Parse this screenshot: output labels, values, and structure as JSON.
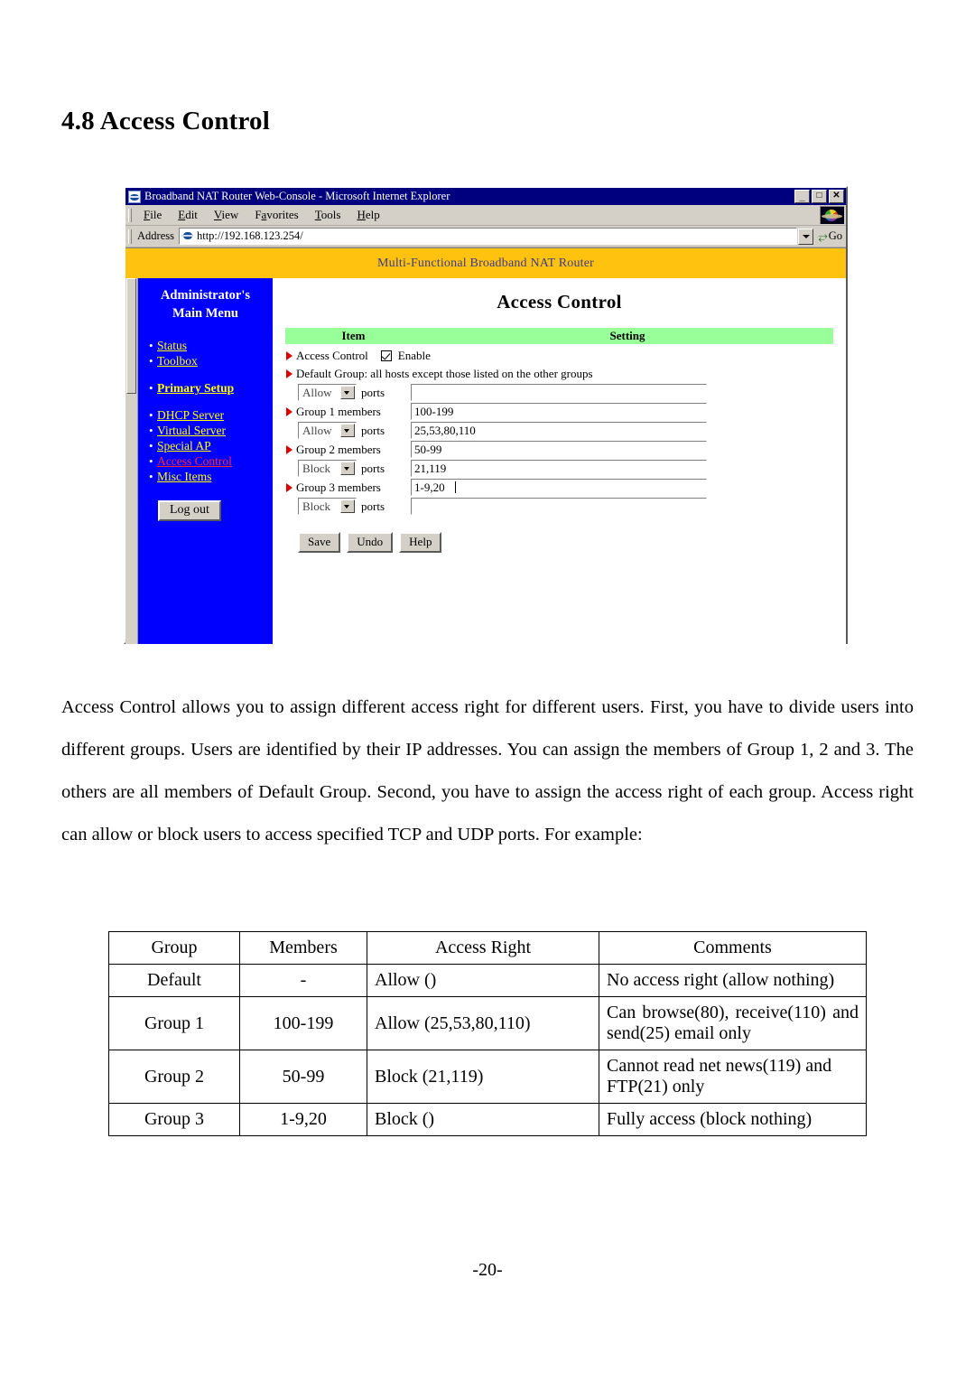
{
  "document": {
    "heading": "4.8 Access Control",
    "page_number": "-20-",
    "paragraph": "Access Control allows you to assign different access right for different users. First, you have to divide users into different groups. Users are identified by their IP addresses. You can assign the members of Group 1, 2 and 3. The others are all members of Default Group. Second, you have to assign the access right of each group. Access right can allow or block users to access specified TCP and UDP ports. For example:"
  },
  "browser": {
    "title": "Broadband NAT Router Web-Console - Microsoft Internet Explorer",
    "title_icon": "ie-document-icon",
    "window_controls": {
      "minimize": "_",
      "maximize": "□",
      "close": "✕"
    },
    "menu": [
      {
        "label": "File",
        "accel": "F"
      },
      {
        "label": "Edit",
        "accel": "E"
      },
      {
        "label": "View",
        "accel": "V"
      },
      {
        "label": "Favorites",
        "accel": "a"
      },
      {
        "label": "Tools",
        "accel": "T"
      },
      {
        "label": "Help",
        "accel": "H"
      }
    ],
    "address": {
      "label": "Address",
      "url": "http://192.168.123.254/",
      "go_label": "Go"
    }
  },
  "router_page": {
    "banner": "Multi-Functional Broadband NAT Router",
    "banner_color": "#ffc20e",
    "sidebar": {
      "background_color": "#0000ff",
      "title_line1": "Administrator's",
      "title_line2": "Main Menu",
      "items": [
        {
          "label": "Status",
          "state": "normal"
        },
        {
          "label": "Toolbox",
          "state": "normal"
        },
        {
          "label": "Primary Setup",
          "state": "bold"
        },
        {
          "label": "DHCP Server",
          "state": "normal"
        },
        {
          "label": "Virtual Server",
          "state": "normal"
        },
        {
          "label": "Special AP",
          "state": "normal"
        },
        {
          "label": "Access Control",
          "state": "active"
        },
        {
          "label": "Misc Items",
          "state": "normal"
        }
      ],
      "logout_label": "Log out",
      "link_color": "#ffff00",
      "active_link_color": "#ff2a2a"
    },
    "content": {
      "title": "Access Control",
      "table_header": {
        "item": "Item",
        "setting": "Setting",
        "color": "#99ff99"
      },
      "access_control": {
        "label": "Access Control",
        "enable_label": "Enable",
        "enabled": true
      },
      "default_group_note": "Default Group: all hosts except those listed on the other groups",
      "rows": [
        {
          "kind": "select",
          "action": "Allow",
          "ports_label": "ports",
          "value": ""
        },
        {
          "kind": "input",
          "label": "Group 1 members",
          "value": "100-199"
        },
        {
          "kind": "select",
          "action": "Allow",
          "ports_label": "ports",
          "value": "25,53,80,110"
        },
        {
          "kind": "input",
          "label": "Group 2 members",
          "value": "50-99"
        },
        {
          "kind": "select",
          "action": "Block",
          "ports_label": "ports",
          "value": "21,119"
        },
        {
          "kind": "input",
          "label": "Group 3 members",
          "value": "1-9,20",
          "focused": true
        },
        {
          "kind": "select",
          "action": "Block",
          "ports_label": "ports",
          "value": ""
        }
      ],
      "buttons": [
        {
          "label": "Save"
        },
        {
          "label": "Undo"
        },
        {
          "label": "Help"
        }
      ]
    }
  },
  "example_table": {
    "columns": [
      "Group",
      "Members",
      "Access Right",
      "Comments"
    ],
    "rows": [
      {
        "group": "Default",
        "members": "-",
        "access_right": "Allow ()",
        "comments": "No access right (allow nothing)"
      },
      {
        "group": "Group 1",
        "members": "100-199",
        "access_right": "Allow (25,53,80,110)",
        "comments": "Can browse(80), receive(110) and send(25) email only"
      },
      {
        "group": "Group 2",
        "members": "50-99",
        "access_right": "Block (21,119)",
        "comments": "Cannot read net news(119) and FTP(21) only"
      },
      {
        "group": "Group 3",
        "members": "1-9,20",
        "access_right": "Block ()",
        "comments": "Fully access (block nothing)"
      }
    ]
  }
}
